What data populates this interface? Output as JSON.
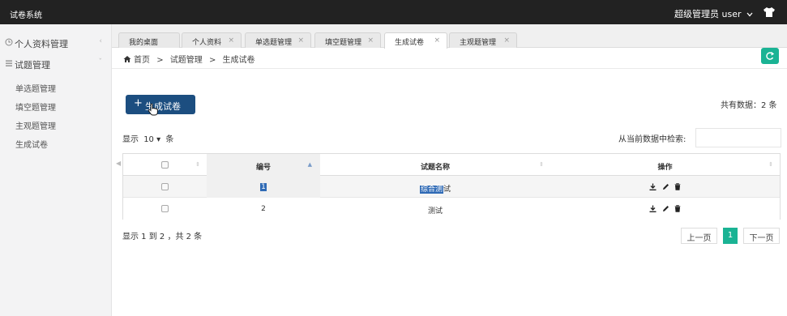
{
  "app": {
    "title": "试卷系统",
    "user_label": "超级管理员",
    "user_name": "user"
  },
  "sidebar": {
    "groups": [
      {
        "label": "个人资料管理"
      },
      {
        "label": "试题管理"
      }
    ],
    "sub_items": [
      {
        "label": "单选题管理"
      },
      {
        "label": "填空题管理"
      },
      {
        "label": "主观题管理"
      },
      {
        "label": "生成试卷"
      }
    ]
  },
  "tabs": [
    {
      "label": "我的桌面"
    },
    {
      "label": "个人资料"
    },
    {
      "label": "单选题管理"
    },
    {
      "label": "填空题管理"
    },
    {
      "label": "生成试卷",
      "active": true
    },
    {
      "label": "主观题管理"
    }
  ],
  "breadcrumb": {
    "home": "首页",
    "sep": ">",
    "level1": "试题管理",
    "level2": "生成试卷"
  },
  "toolbar": {
    "generate_label": "生成试卷",
    "plus": "+"
  },
  "summary": {
    "total_label": "共有数据：2 条"
  },
  "controls": {
    "show_prefix": "显示",
    "page_size": "10",
    "show_suffix": "条",
    "search_label": "从当前数据中检索:",
    "search_value": ""
  },
  "table": {
    "headers": {
      "id": "编号",
      "name": "试题名称",
      "ops": "操作"
    },
    "rows": [
      {
        "id": "1",
        "name_selected": "综合测",
        "name_rest": "试"
      },
      {
        "id": "2",
        "name": "测试"
      }
    ]
  },
  "footer": {
    "info": "显示 1 到 2 ，共 2 条",
    "prev": "上一页",
    "current": "1",
    "next": "下一页"
  },
  "colors": {
    "accent": "#1ab394",
    "primary": "#1c4e80",
    "topbar": "#222222"
  },
  "icons": [
    "home-icon",
    "refresh-icon",
    "shirt-icon",
    "download-icon",
    "edit-icon",
    "delete-icon"
  ]
}
